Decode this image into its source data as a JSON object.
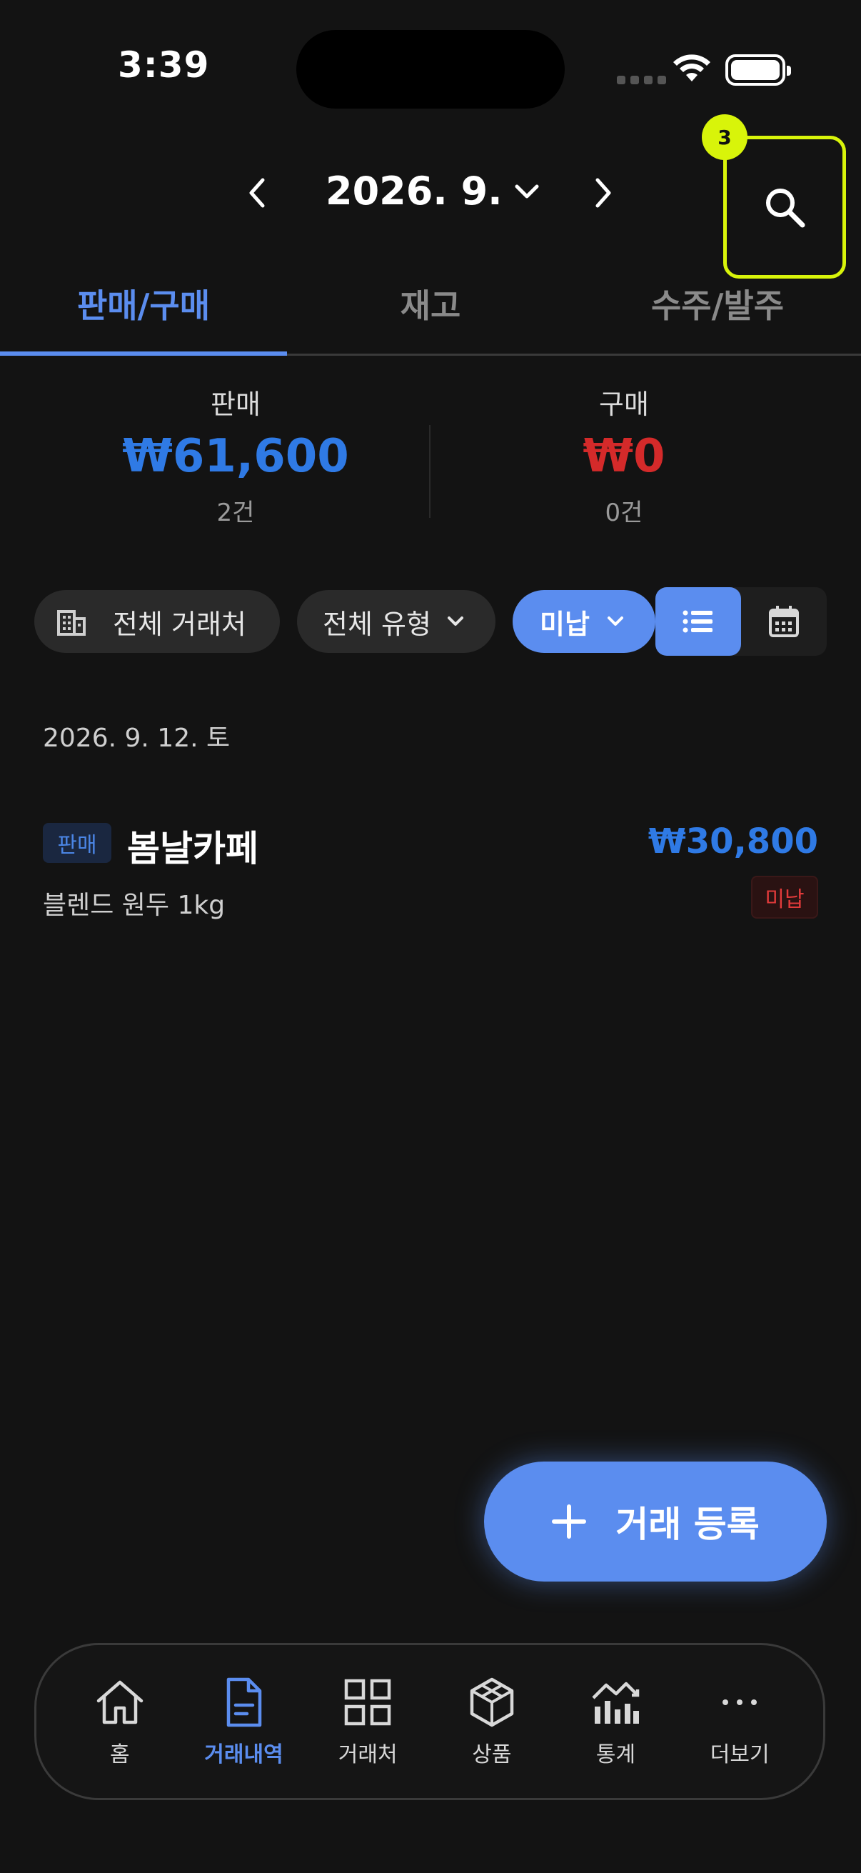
{
  "status_bar": {
    "time": "3:39"
  },
  "header": {
    "month": "2026. 9.",
    "badge_number": "3"
  },
  "tabs": [
    {
      "label": "판매/구매",
      "active": true
    },
    {
      "label": "재고",
      "active": false
    },
    {
      "label": "수주/발주",
      "active": false
    }
  ],
  "summary": {
    "sales": {
      "label": "판매",
      "value": "₩61,600",
      "count": "2건",
      "color": "#2f7ae5"
    },
    "purchase": {
      "label": "구매",
      "value": "₩0",
      "count": "0건",
      "color": "#d42a2a"
    }
  },
  "filters": {
    "partner": "전체 거래처",
    "type": "전체 유형",
    "payment": "미납"
  },
  "list": {
    "date": "2026. 9. 12. 토",
    "rows": [
      {
        "type": "판매",
        "name": "봄날카페",
        "amount": "₩30,800",
        "item": "블렌드 원두 1kg",
        "status": "미납"
      }
    ]
  },
  "fab": {
    "label": "거래 등록"
  },
  "bottom_nav": [
    {
      "label": "홈",
      "icon": "home-icon"
    },
    {
      "label": "거래내역",
      "icon": "document-icon",
      "active": true
    },
    {
      "label": "거래처",
      "icon": "grid-icon"
    },
    {
      "label": "상품",
      "icon": "cube-icon"
    },
    {
      "label": "통계",
      "icon": "chart-icon"
    },
    {
      "label": "더보기",
      "icon": "more-icon"
    }
  ],
  "colors": {
    "accent": "#5b8def",
    "highlight": "#d8f40a",
    "background": "#131313"
  }
}
